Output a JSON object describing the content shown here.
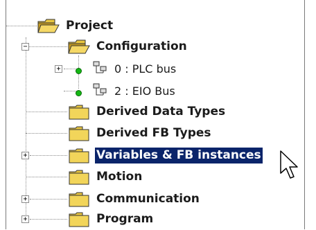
{
  "tree": {
    "root": {
      "label": "Project",
      "icon": "open-folder-icon"
    },
    "configuration": {
      "label": "Configuration",
      "icon": "open-folder-icon",
      "expander": "−"
    },
    "configuration_children": [
      {
        "label": "0 : PLC bus",
        "icon": "network-node-icon",
        "expander": "+"
      },
      {
        "label": "2 : EIO Bus",
        "icon": "network-node-icon"
      }
    ],
    "items": [
      {
        "label": "Derived Data Types",
        "icon": "folder-icon"
      },
      {
        "label": "Derived FB Types",
        "icon": "folder-icon"
      },
      {
        "label": "Variables & FB instances",
        "icon": "folder-icon",
        "expander": "+",
        "selected": true
      },
      {
        "label": "Motion",
        "icon": "folder-icon"
      },
      {
        "label": "Communication",
        "icon": "folder-icon",
        "expander": "+"
      },
      {
        "label": "Program",
        "icon": "folder-icon",
        "expander": "+"
      }
    ],
    "selection_color": "#0a246a",
    "folder_color": "#f2d55a"
  }
}
